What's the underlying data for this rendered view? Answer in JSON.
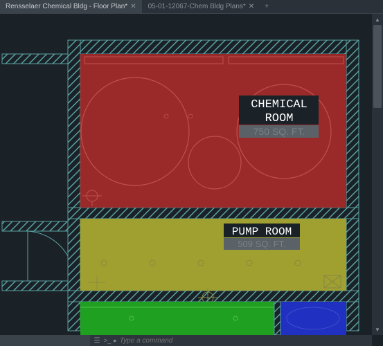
{
  "tabs": [
    {
      "label": "Rensselaer Chemical Bldg - Floor Plan*",
      "active": true
    },
    {
      "label": "05-01-12067-Chem Bldg Plans*",
      "active": false
    }
  ],
  "command_line": {
    "placeholder": "Type a command",
    "prompt_indicator": ">_"
  },
  "rooms": {
    "chemical": {
      "name_line1": "CHEMICAL",
      "name_line2": "ROOM",
      "area": "750 SQ. FT."
    },
    "pump": {
      "name_line1": "PUMP ROOM",
      "area": "509 SQ. FT."
    }
  },
  "colors": {
    "wall_hatch": "#5aa0a0",
    "chemical_room": "#9a2a2a",
    "pump_room": "#a0a030",
    "green_room": "#20a020",
    "blue_room": "#2030c0",
    "circle_line": "#c05050",
    "background": "#1a2228"
  }
}
